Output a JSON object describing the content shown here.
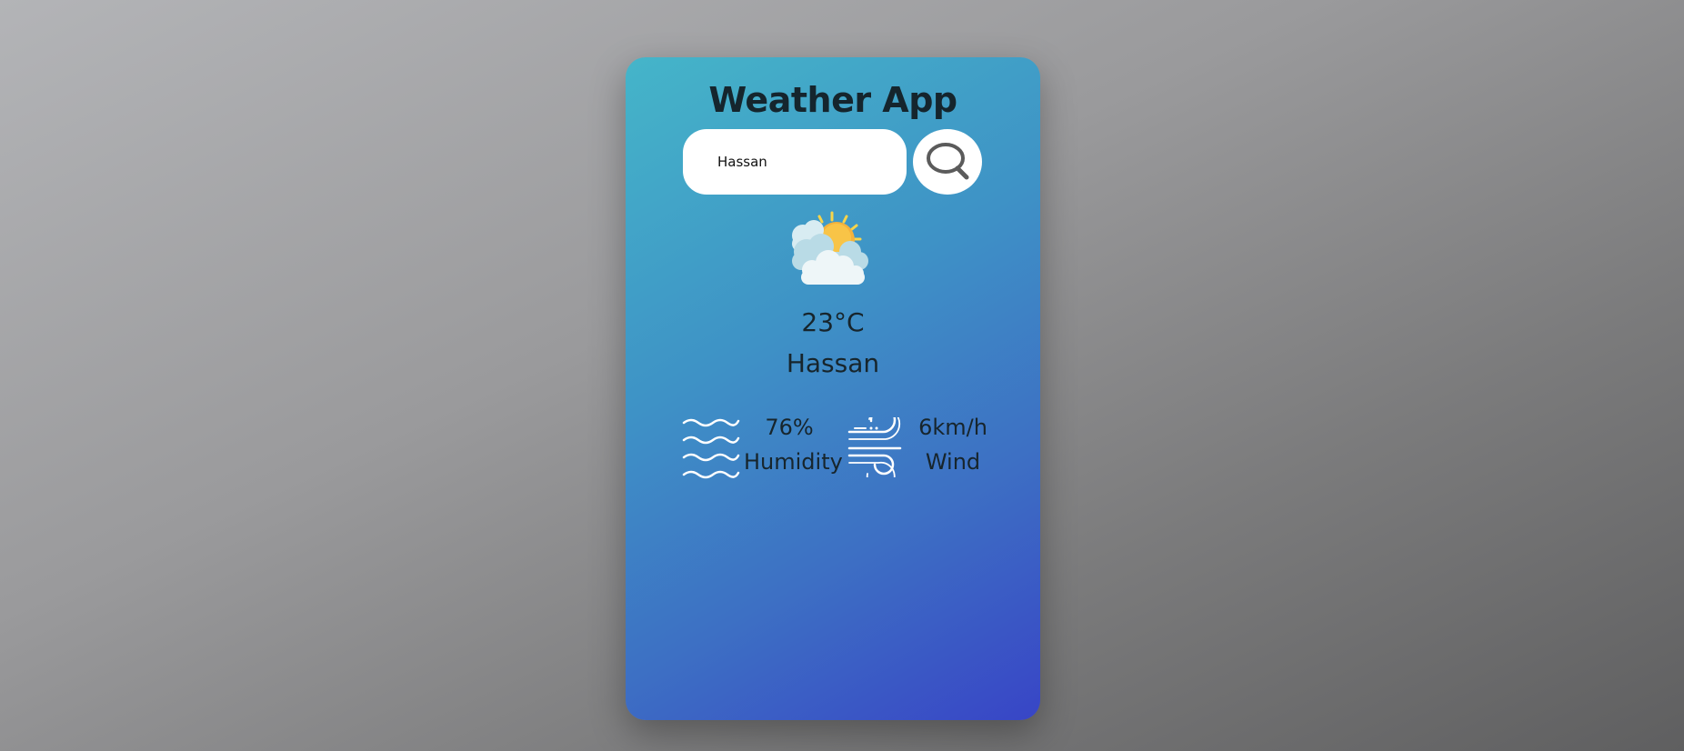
{
  "app": {
    "title": "Weather App"
  },
  "search": {
    "value": "Hassan",
    "button_icon": "search-icon"
  },
  "weather": {
    "icon": "partly-cloudy-sun-icon",
    "temperature": "23°C",
    "city": "Hassan"
  },
  "details": {
    "humidity": {
      "icon": "humidity-waves-icon",
      "value": "76%",
      "label": "Humidity"
    },
    "wind": {
      "icon": "wind-icon",
      "value": "6km/h",
      "label": "Wind"
    }
  },
  "colors": {
    "card_gradient_start": "#45b5c9",
    "card_gradient_end": "#3845c6",
    "text": "#17252c",
    "search_bg": "#ffffff"
  }
}
